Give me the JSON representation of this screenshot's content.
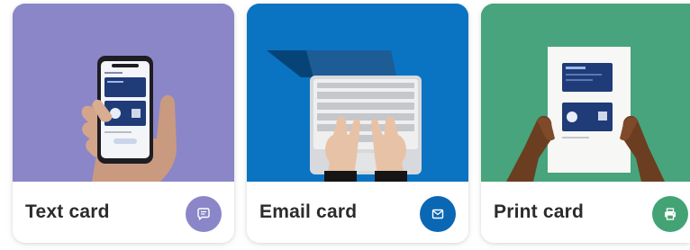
{
  "cards": [
    {
      "title": "Text card",
      "icon": "message-icon",
      "image": "hand-holding-phone",
      "bg_color": "#8a86c8",
      "action_color": "#8a86c8"
    },
    {
      "title": "Email card",
      "icon": "envelope-icon",
      "image": "hands-typing-on-laptop",
      "bg_color": "#0a74c2",
      "action_color": "#0a67b3"
    },
    {
      "title": "Print card",
      "icon": "printer-icon",
      "image": "hands-holding-printed-card",
      "bg_color": "#47a47c",
      "action_color": "#43a374"
    }
  ]
}
